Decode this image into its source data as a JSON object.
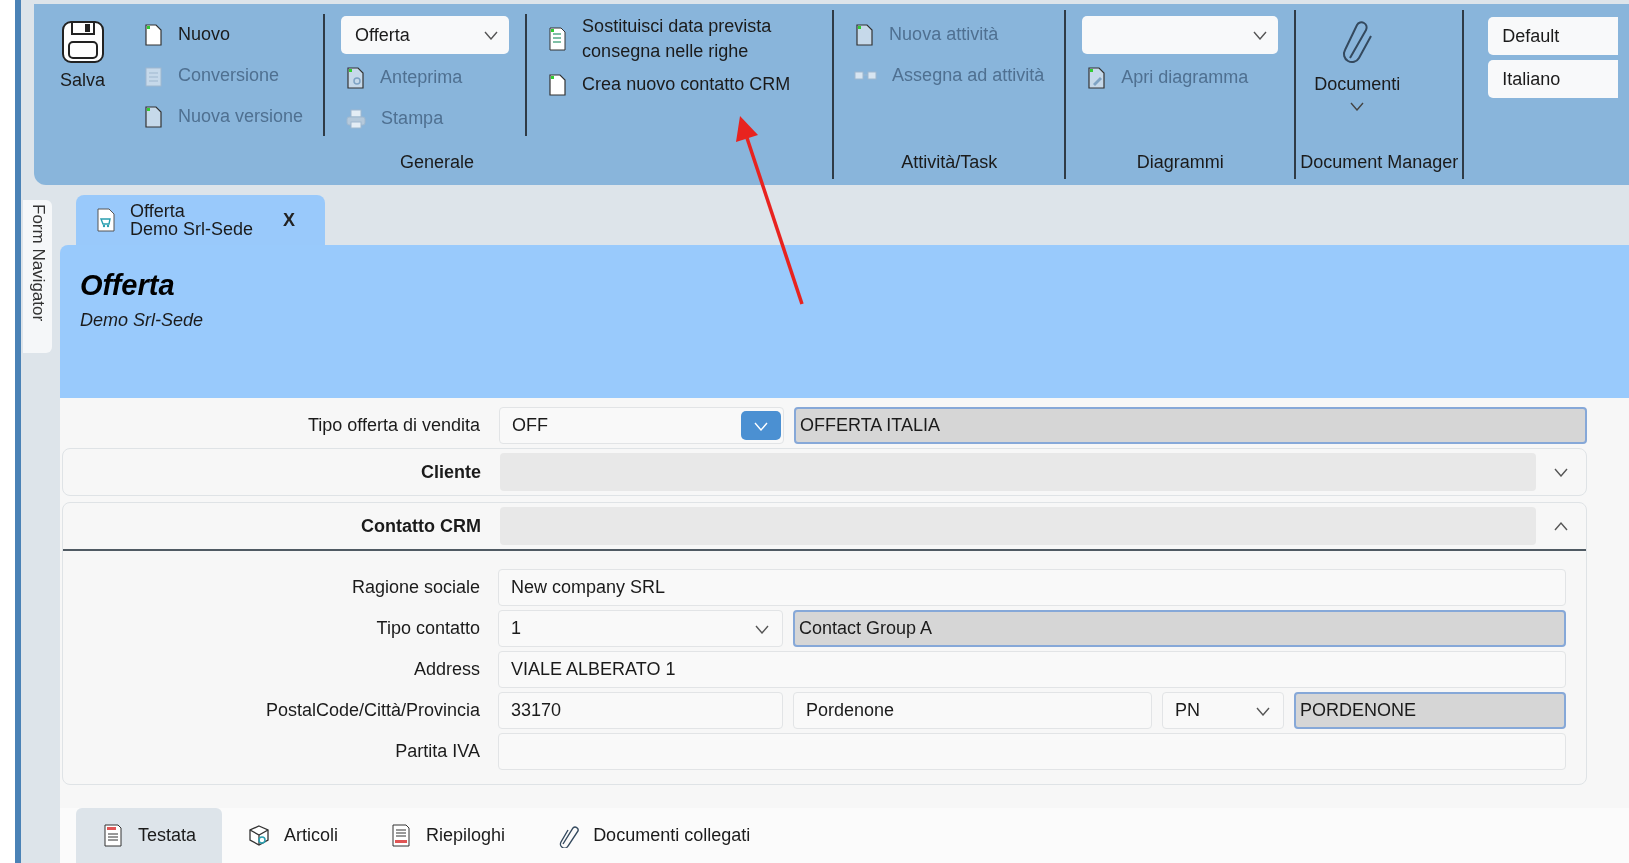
{
  "ribbon": {
    "groups": [
      {
        "label": "Generale",
        "columns": [
          [
            {
              "kind": "large",
              "label": "Salva",
              "menu": false,
              "disabled": false
            }
          ],
          [
            {
              "kind": "small",
              "label": "Nuovo",
              "disabled": false
            },
            {
              "kind": "small",
              "label": "Conversione",
              "disabled": true
            },
            {
              "kind": "small",
              "label": "Nuova versione",
              "disabled": true
            }
          ],
          [
            {
              "kind": "dropdown",
              "value": "Offerta"
            },
            {
              "kind": "small",
              "label": "Anteprima",
              "disabled": true
            },
            {
              "kind": "small",
              "label": "Stampa",
              "disabled": true
            }
          ],
          [
            {
              "kind": "small",
              "label": "Sostituisci data prevista consegna nelle righe",
              "disabled": false
            },
            {
              "kind": "small",
              "label": "Crea nuovo contatto CRM",
              "disabled": false
            }
          ]
        ]
      },
      {
        "label": "Attività/Task",
        "columns": [
          [
            {
              "kind": "small",
              "label": "Nuova attività",
              "disabled": true
            },
            {
              "kind": "small",
              "label": "Assegna ad attività",
              "disabled": true
            }
          ]
        ]
      },
      {
        "label": "Diagrammi",
        "columns": [
          [
            {
              "kind": "dropdown"
            },
            {
              "kind": "small",
              "label": "Apri diagramma",
              "disabled": true
            }
          ]
        ]
      },
      {
        "label": "Document Manager",
        "columns": [
          [
            {
              "kind": "large",
              "label": "Documenti",
              "menu": true,
              "disabled": false
            }
          ]
        ]
      },
      {
        "columns": [
          [
            {
              "kind": "selector",
              "value": "Default"
            },
            {
              "kind": "selector",
              "value": "Italiano"
            }
          ]
        ]
      }
    ]
  },
  "side_tab": {
    "label": "Form Navigator"
  },
  "document_tab": {
    "title": "Offerta",
    "subtitle": "Demo Srl-Sede",
    "close": "X",
    "selected": true
  },
  "header": {
    "title": "Offerta",
    "subtitle": "Demo Srl-Sede"
  },
  "form": {
    "rows": [
      {
        "label": "Tipo offerta di vendita",
        "fields": [
          {
            "kind": "combo",
            "value": "OFF"
          },
          {
            "kind": "readonly",
            "value": "OFFERTA ITALIA"
          }
        ]
      }
    ],
    "sections": [
      {
        "label": "Cliente",
        "expanded": false
      },
      {
        "label": "Contatto CRM",
        "expanded": true,
        "rows": [
          {
            "label": "Ragione sociale",
            "fields": [
              {
                "kind": "text",
                "value": "New company SRL"
              }
            ]
          },
          {
            "label": "Tipo contatto",
            "fields": [
              {
                "kind": "dropdown",
                "value": "1"
              },
              {
                "kind": "readonly",
                "value": "Contact Group A"
              }
            ]
          },
          {
            "label": "Address",
            "fields": [
              {
                "kind": "text",
                "value": "VIALE ALBERATO 1"
              }
            ]
          },
          {
            "label": "PostalCode/Città/Provincia",
            "fields": [
              {
                "kind": "text",
                "value": "33170"
              },
              {
                "kind": "text",
                "value": "Pordenone"
              },
              {
                "kind": "dropdown",
                "value": "PN"
              },
              {
                "kind": "readonly",
                "value": "PORDENONE"
              }
            ]
          },
          {
            "label": "Partita IVA",
            "fields": [
              {
                "kind": "text"
              }
            ]
          }
        ]
      }
    ]
  },
  "bottom_tabs": [
    {
      "label": "Testata",
      "selected": true
    },
    {
      "label": "Articoli",
      "selected": false
    },
    {
      "label": "Riepiloghi",
      "selected": false
    },
    {
      "label": "Documenti collegati",
      "selected": false
    }
  ]
}
